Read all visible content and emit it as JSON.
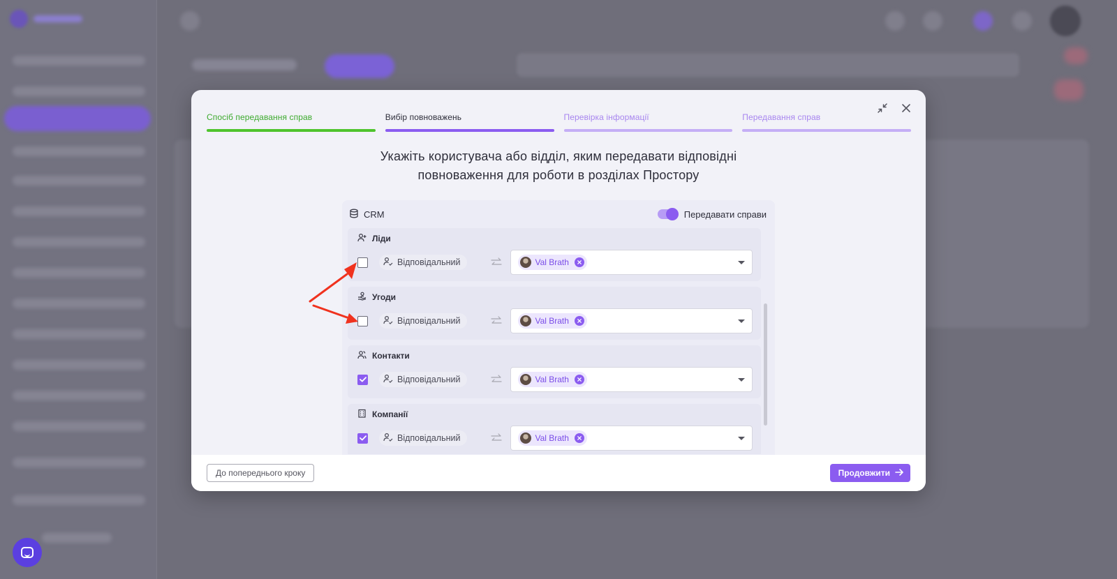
{
  "colors": {
    "accent": "#8b5cf0",
    "success": "#4fc42d",
    "annotation": "#f0321e"
  },
  "steps": [
    {
      "label": "Спосіб передавання справ",
      "state": "done"
    },
    {
      "label": "Вибір повноважень",
      "state": "current"
    },
    {
      "label": "Перевірка інформації",
      "state": "todo"
    },
    {
      "label": "Передавання справ",
      "state": "todo"
    }
  ],
  "heading": {
    "line1": "Укажіть користувача або відділ, яким передавати відповідні",
    "line2": "повноваження для роботи в розділах Простору"
  },
  "crm": {
    "title": "CRM",
    "icon": "database-icon",
    "toggle_label": "Передавати справи",
    "toggle_on": true,
    "sections": [
      {
        "title": "Ліди",
        "icon": "user-plus-icon",
        "checked": false,
        "role": "Відповідальний",
        "user": "Val Brath"
      },
      {
        "title": "Угоди",
        "icon": "handshake-icon",
        "checked": false,
        "role": "Відповідальний",
        "user": "Val Brath"
      },
      {
        "title": "Контакти",
        "icon": "users-icon",
        "checked": true,
        "role": "Відповідальний",
        "user": "Val Brath"
      },
      {
        "title": "Компанії",
        "icon": "building-icon",
        "checked": true,
        "role": "Відповідальний",
        "user": "Val Brath"
      }
    ]
  },
  "footer": {
    "back_label": "До попереднього кроку",
    "next_label": "Продовжити"
  }
}
